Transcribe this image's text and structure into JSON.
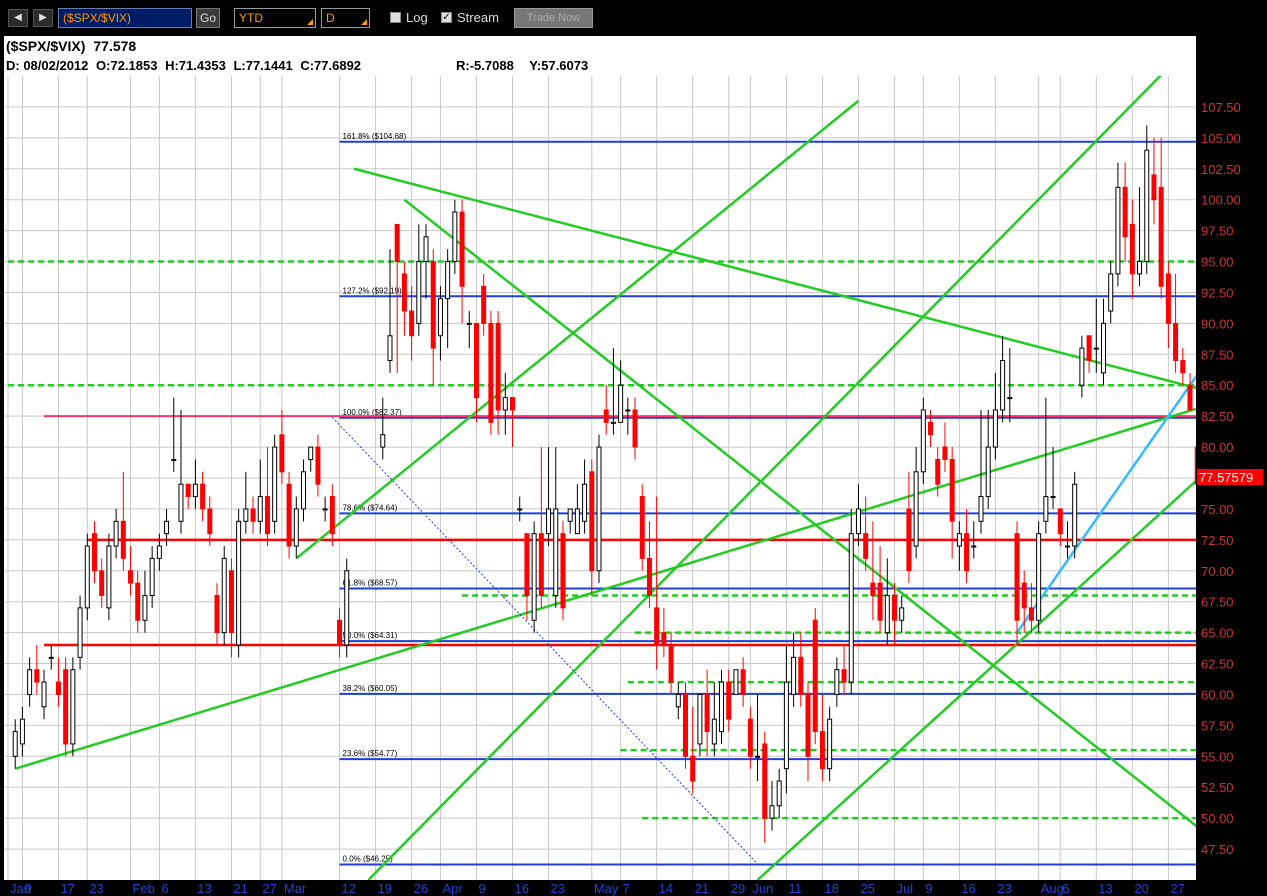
{
  "toolbar": {
    "prev_icon": "chevron-left-icon",
    "next_icon": "chevron-right-icon",
    "prev_glyph": "◀",
    "next_glyph": "▶",
    "symbol_value": "($SPX/$VIX)",
    "go_label": "Go",
    "period_value": "YTD",
    "interval_value": "D",
    "log_label": "Log",
    "log_checked": false,
    "stream_label": "Stream",
    "stream_checked": true,
    "check_glyph": "✓",
    "trade_label": "Trade Now"
  },
  "header": {
    "symbol": "($SPX/$VIX)",
    "last": "77.578",
    "date": "D: 08/02/2012",
    "open": "O:72.1853",
    "high": "H:71.4353",
    "low": "L:77.1441",
    "close": "C:77.6892",
    "r_value": "R:-5.7088",
    "y_value": "Y:57.6073"
  },
  "colors": {
    "up_candle": "#ffffff",
    "down_candle": "#ff0000",
    "candle_outline": "#000000",
    "fib_line": "#1f3fd8",
    "trend_line": "#22cc22",
    "dashed_line": "#22cc22",
    "red_line": "#ff0000",
    "pink_line": "#ff3366",
    "blue_trend": "#33bbff",
    "y_label": "#cc3333",
    "last_badge_bg": "#ff0000",
    "last_badge_fg": "#ffffff",
    "x_label": "#2244cc",
    "grid": "#c8c8c8"
  },
  "chart_data": {
    "type": "candlestick",
    "ylim": [
      45,
      110
    ],
    "yticks": [
      "47.50",
      "50.00",
      "52.50",
      "55.00",
      "57.50",
      "60.00",
      "62.50",
      "65.00",
      "67.50",
      "70.00",
      "72.50",
      "75.00",
      "77.50",
      "80.00",
      "82.50",
      "85.00",
      "87.50",
      "90.00",
      "92.50",
      "95.00",
      "97.50",
      "100.00",
      "102.50",
      "105.00",
      "107.50"
    ],
    "xticks": [
      {
        "label": "Jan",
        "day": 0
      },
      {
        "label": "9",
        "day": 2
      },
      {
        "label": "17",
        "day": 7
      },
      {
        "label": "23",
        "day": 11
      },
      {
        "label": "Feb",
        "day": 17
      },
      {
        "label": "6",
        "day": 21
      },
      {
        "label": "13",
        "day": 26
      },
      {
        "label": "21",
        "day": 31
      },
      {
        "label": "27",
        "day": 35
      },
      {
        "label": "Mar",
        "day": 38
      },
      {
        "label": "12",
        "day": 46
      },
      {
        "label": "19",
        "day": 51
      },
      {
        "label": "26",
        "day": 56
      },
      {
        "label": "Apr",
        "day": 60
      },
      {
        "label": "9",
        "day": 65
      },
      {
        "label": "16",
        "day": 70
      },
      {
        "label": "23",
        "day": 75
      },
      {
        "label": "May",
        "day": 81
      },
      {
        "label": "7",
        "day": 85
      },
      {
        "label": "14",
        "day": 90
      },
      {
        "label": "21",
        "day": 95
      },
      {
        "label": "29",
        "day": 100
      },
      {
        "label": "Jun",
        "day": 103
      },
      {
        "label": "11",
        "day": 108
      },
      {
        "label": "18",
        "day": 113
      },
      {
        "label": "25",
        "day": 118
      },
      {
        "label": "Jul",
        "day": 123
      },
      {
        "label": "9",
        "day": 127
      },
      {
        "label": "16",
        "day": 132
      },
      {
        "label": "23",
        "day": 137
      },
      {
        "label": "Aug",
        "day": 143
      },
      {
        "label": "6",
        "day": 146
      },
      {
        "label": "13",
        "day": 151
      },
      {
        "label": "20",
        "day": 156
      },
      {
        "label": "27",
        "day": 161
      }
    ],
    "day_range": [
      0,
      164
    ],
    "candles": [
      [
        1,
        55,
        57,
        54,
        58
      ],
      [
        2,
        56,
        58,
        55,
        59
      ],
      [
        3,
        60,
        62,
        59,
        63
      ],
      [
        4,
        62,
        61,
        60,
        64
      ],
      [
        5,
        59,
        61,
        58,
        62
      ],
      [
        6,
        63,
        63,
        62,
        64
      ],
      [
        7,
        61,
        60,
        59,
        63
      ],
      [
        8,
        62,
        56,
        55,
        63
      ],
      [
        9,
        56,
        62,
        55,
        63
      ],
      [
        10,
        63,
        67,
        62,
        68
      ],
      [
        11,
        67,
        72,
        66,
        73
      ],
      [
        12,
        73,
        70,
        69,
        74
      ],
      [
        13,
        70,
        68,
        67,
        71
      ],
      [
        14,
        67,
        72,
        66,
        73
      ],
      [
        15,
        72,
        74,
        71,
        75
      ],
      [
        16,
        74,
        71,
        70,
        78
      ],
      [
        17,
        70,
        69,
        68,
        72
      ],
      [
        18,
        69,
        66,
        65,
        70
      ],
      [
        19,
        66,
        68,
        65,
        70
      ],
      [
        20,
        68,
        71,
        67,
        72
      ],
      [
        21,
        71,
        72,
        70,
        73
      ],
      [
        22,
        73,
        74,
        72,
        75
      ],
      [
        23,
        79,
        79,
        78,
        84
      ],
      [
        24,
        74,
        77,
        73,
        83
      ],
      [
        25,
        77,
        76,
        75,
        77
      ],
      [
        26,
        76,
        77,
        75,
        79
      ],
      [
        27,
        77,
        75,
        74,
        78
      ],
      [
        28,
        75,
        73,
        72,
        76
      ],
      [
        29,
        68,
        65,
        64,
        69
      ],
      [
        30,
        65,
        71,
        64,
        72
      ],
      [
        31,
        70,
        65,
        63,
        71
      ],
      [
        32,
        64,
        74,
        63,
        75
      ],
      [
        33,
        74,
        75,
        73,
        78
      ],
      [
        34,
        75,
        74,
        73,
        76
      ],
      [
        35,
        74,
        76,
        73,
        79
      ],
      [
        36,
        76,
        73,
        72,
        80
      ],
      [
        37,
        74,
        80,
        73,
        81
      ],
      [
        38,
        81,
        78,
        77,
        83
      ],
      [
        39,
        77,
        72,
        71,
        78
      ],
      [
        40,
        72,
        75,
        71,
        76
      ],
      [
        41,
        75,
        78,
        74,
        79
      ],
      [
        42,
        79,
        80,
        78,
        80
      ],
      [
        43,
        80,
        77,
        76,
        81
      ],
      [
        44,
        75,
        75,
        74,
        76
      ],
      [
        45,
        76,
        73,
        72,
        77
      ],
      [
        46,
        66,
        64,
        63,
        67
      ],
      [
        47,
        64,
        70,
        63,
        71
      ],
      [
        52,
        80,
        81,
        79,
        84
      ],
      [
        53,
        87,
        89,
        86,
        96
      ],
      [
        54,
        98,
        95,
        86,
        98
      ],
      [
        55,
        94,
        91,
        89,
        95
      ],
      [
        56,
        91,
        89,
        87,
        93
      ],
      [
        57,
        90,
        95,
        89,
        98
      ],
      [
        58,
        95,
        97,
        92,
        98
      ],
      [
        59,
        95,
        88,
        85,
        96
      ],
      [
        60,
        89,
        92,
        87,
        93
      ],
      [
        61,
        92,
        95,
        88,
        96
      ],
      [
        62,
        95,
        99,
        94,
        100
      ],
      [
        63,
        99,
        93,
        90,
        100
      ],
      [
        64,
        90,
        90,
        88,
        91
      ],
      [
        65,
        90,
        84,
        82,
        90
      ],
      [
        66,
        93,
        90,
        89,
        94
      ],
      [
        67,
        90,
        82,
        81,
        91
      ],
      [
        68,
        90,
        83,
        81,
        91
      ],
      [
        69,
        83,
        84,
        81,
        86
      ],
      [
        70,
        84,
        83,
        80,
        84
      ],
      [
        71,
        75,
        75,
        74,
        76
      ],
      [
        72,
        73,
        68,
        66,
        73
      ],
      [
        73,
        66,
        73,
        65,
        74
      ],
      [
        74,
        73,
        68,
        67,
        80
      ],
      [
        75,
        73,
        75,
        72,
        80
      ],
      [
        76,
        68,
        75,
        67,
        80
      ],
      [
        77,
        73,
        67,
        66,
        74
      ],
      [
        78,
        74,
        75,
        73,
        75
      ],
      [
        79,
        73,
        75,
        73,
        77
      ],
      [
        80,
        74,
        77,
        73,
        79
      ],
      [
        81,
        78,
        70,
        68,
        79
      ],
      [
        82,
        70,
        80,
        69,
        81
      ],
      [
        83,
        83,
        82,
        81,
        85
      ],
      [
        84,
        82,
        82,
        81,
        88
      ],
      [
        85,
        82,
        85,
        83,
        87
      ],
      [
        86,
        83,
        83,
        81,
        84
      ],
      [
        87,
        83,
        80,
        79,
        84
      ],
      [
        88,
        76,
        71,
        70,
        77
      ],
      [
        89,
        71,
        68,
        67,
        74
      ],
      [
        90,
        67,
        64,
        62,
        76
      ],
      [
        91,
        65,
        64,
        63,
        67
      ],
      [
        92,
        64,
        61,
        60,
        65
      ],
      [
        93,
        59,
        60,
        58,
        61
      ],
      [
        94,
        60,
        55,
        54,
        61
      ],
      [
        95,
        55,
        53,
        52,
        59
      ],
      [
        96,
        56,
        60,
        55,
        60
      ],
      [
        97,
        60,
        57,
        55,
        62
      ],
      [
        98,
        56,
        58,
        55,
        61
      ],
      [
        99,
        57,
        61,
        56,
        62
      ],
      [
        100,
        61,
        58,
        57,
        62
      ],
      [
        101,
        60,
        62,
        60,
        62
      ],
      [
        102,
        62,
        60,
        59,
        63
      ],
      [
        103,
        58,
        55,
        54,
        59
      ],
      [
        104,
        55,
        55,
        53,
        60
      ],
      [
        105,
        56,
        50,
        48,
        57
      ],
      [
        106,
        50,
        51,
        49,
        53
      ],
      [
        107,
        51,
        53,
        50,
        54
      ],
      [
        108,
        54,
        61,
        52,
        64
      ],
      [
        109,
        60,
        63,
        59,
        65
      ],
      [
        110,
        63,
        60,
        59,
        65
      ],
      [
        111,
        60,
        55,
        53,
        61
      ],
      [
        112,
        66,
        57,
        56,
        67
      ],
      [
        113,
        57,
        54,
        53,
        60
      ],
      [
        114,
        54,
        58,
        53,
        59
      ],
      [
        115,
        60,
        62,
        59,
        63
      ],
      [
        116,
        62,
        61,
        60,
        64
      ],
      [
        117,
        61,
        73,
        60,
        75
      ],
      [
        118,
        73,
        75,
        72,
        77
      ],
      [
        119,
        73,
        71,
        70,
        76
      ],
      [
        120,
        69,
        68,
        66,
        74
      ],
      [
        121,
        69,
        66,
        65,
        72
      ],
      [
        122,
        65,
        68,
        64,
        71
      ],
      [
        123,
        68,
        66,
        64,
        69
      ],
      [
        124,
        66,
        67,
        65,
        68
      ],
      [
        125,
        75,
        70,
        69,
        78
      ],
      [
        126,
        72,
        78,
        71,
        80
      ],
      [
        127,
        78,
        83,
        77,
        84
      ],
      [
        128,
        82,
        81,
        80,
        83
      ],
      [
        129,
        79,
        77,
        76,
        80
      ],
      [
        130,
        80,
        79,
        78,
        82
      ],
      [
        131,
        79,
        74,
        71,
        80
      ],
      [
        132,
        72,
        73,
        70,
        74
      ],
      [
        133,
        73,
        70,
        69,
        75
      ],
      [
        134,
        72,
        72,
        71,
        74
      ],
      [
        135,
        74,
        76,
        73,
        83
      ],
      [
        136,
        76,
        80,
        75,
        83
      ],
      [
        137,
        80,
        83,
        79,
        86
      ],
      [
        138,
        83,
        87,
        82,
        89
      ],
      [
        139,
        84,
        84,
        82,
        88
      ],
      [
        140,
        73,
        66,
        64,
        74
      ],
      [
        141,
        69,
        67,
        65,
        70
      ],
      [
        142,
        67,
        66,
        65,
        69
      ],
      [
        143,
        66,
        73,
        65,
        74
      ],
      [
        144,
        74,
        76,
        73,
        84
      ],
      [
        145,
        76,
        76,
        75,
        80
      ],
      [
        146,
        75,
        73,
        72,
        75
      ],
      [
        147,
        72,
        72,
        71,
        74
      ],
      [
        148,
        72,
        77,
        71,
        78
      ],
      [
        149,
        85,
        88,
        84,
        89
      ],
      [
        150,
        89,
        87,
        86,
        89
      ],
      [
        151,
        88,
        88,
        86,
        92
      ],
      [
        152,
        86,
        90,
        85,
        92
      ],
      [
        153,
        91,
        94,
        90,
        95
      ],
      [
        154,
        94,
        101,
        93,
        103
      ],
      [
        155,
        101,
        97,
        95,
        103
      ],
      [
        156,
        98,
        94,
        92,
        100
      ],
      [
        157,
        94,
        95,
        93,
        101
      ],
      [
        158,
        95,
        104,
        94,
        106
      ],
      [
        159,
        102,
        100,
        98,
        105
      ],
      [
        160,
        101,
        93,
        92,
        105
      ],
      [
        161,
        94,
        90,
        88,
        95
      ],
      [
        162,
        90,
        87,
        86,
        94
      ],
      [
        163,
        87,
        86,
        85,
        88
      ],
      [
        164,
        85,
        83,
        83,
        86
      ],
      [
        165,
        80,
        77,
        77,
        81
      ]
    ],
    "fib_levels": [
      {
        "label": "161.8% ($104.68)",
        "value": 104.68
      },
      {
        "label": "127.2% ($92.19)",
        "value": 92.19
      },
      {
        "label": "100.0% ($82.37)",
        "value": 82.37
      },
      {
        "label": "78.6% ($74.64)",
        "value": 74.64
      },
      {
        "label": "61.8% ($68.57)",
        "value": 68.57
      },
      {
        "label": "50.0% ($64.31)",
        "value": 64.31
      },
      {
        "label": "38.2% ($60.05)",
        "value": 60.05
      },
      {
        "label": "23.6% ($54.77)",
        "value": 54.77
      },
      {
        "label": "0.0% ($46.25)",
        "value": 46.25
      }
    ],
    "dashed_levels": [
      {
        "value": 95.0,
        "from_day": 0
      },
      {
        "value": 85.0,
        "from_day": 0
      },
      {
        "value": 68.0,
        "from_day": 63
      },
      {
        "value": 65.0,
        "from_day": 87
      },
      {
        "value": 61.0,
        "from_day": 86
      },
      {
        "value": 55.5,
        "from_day": 85
      },
      {
        "value": 50.0,
        "from_day": 88
      }
    ],
    "horizontal_red": [
      {
        "value": 72.5,
        "from_day": 11,
        "color": "red"
      },
      {
        "value": 64.0,
        "from_day": 5,
        "color": "red"
      },
      {
        "value": 82.5,
        "from_day": 5,
        "color": "pink"
      }
    ],
    "trend_lines": [
      {
        "from": [
          1,
          54
        ],
        "to": [
          170,
          84
        ],
        "color": "green"
      },
      {
        "from": [
          40,
          71
        ],
        "to": [
          118,
          108
        ],
        "color": "green"
      },
      {
        "from": [
          48,
          102.5
        ],
        "to": [
          170,
          84
        ],
        "color": "green"
      },
      {
        "from": [
          55,
          100
        ],
        "to": [
          170,
          47
        ],
        "color": "green"
      },
      {
        "from": [
          50,
          45
        ],
        "to": [
          170,
          116
        ],
        "color": "green"
      },
      {
        "from": [
          104,
          45
        ],
        "to": [
          170,
          80
        ],
        "color": "green"
      },
      {
        "from": [
          140,
          65
        ],
        "to": [
          170,
          90
        ],
        "color": "blue"
      },
      {
        "from": [
          45,
          82.4
        ],
        "to": [
          104,
          46.3
        ],
        "color": "blue-dotted"
      }
    ],
    "last_value_label": "77.57579",
    "last_value": 77.58
  }
}
